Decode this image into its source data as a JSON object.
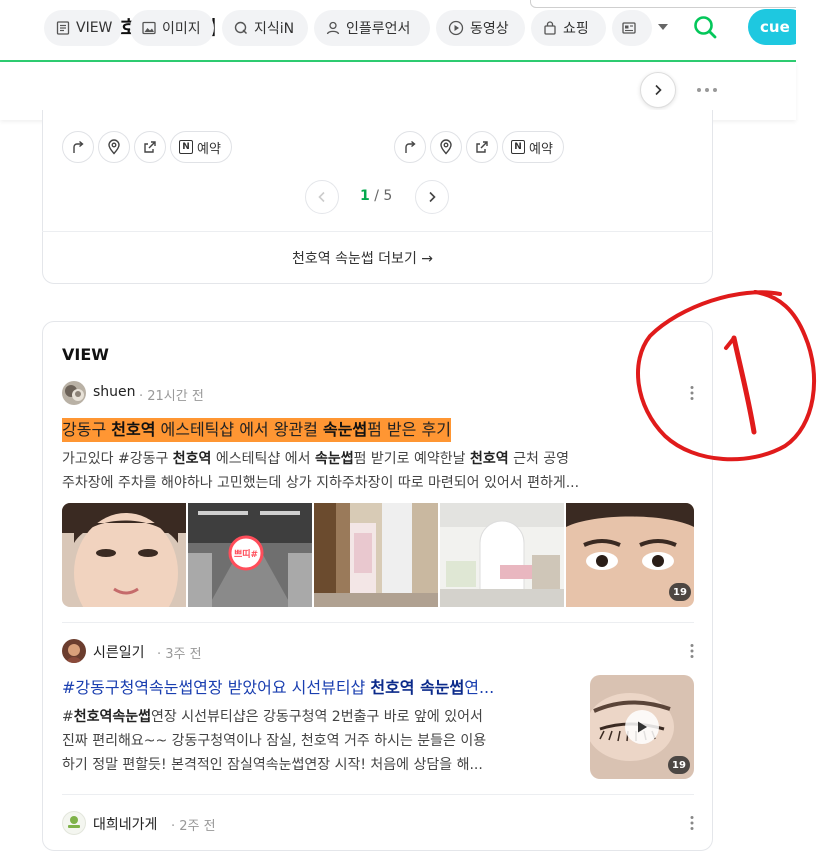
{
  "header": {
    "query": "천호역 속눈썹",
    "cue_label": "cue"
  },
  "tabs": [
    {
      "label": "VIEW",
      "icon": "document-icon"
    },
    {
      "label": "이미지",
      "icon": "image-icon"
    },
    {
      "label": "지식iN",
      "icon": "q-icon"
    },
    {
      "label": "인플루언서",
      "icon": "person-icon"
    },
    {
      "label": "동영상",
      "icon": "play-icon"
    },
    {
      "label": "쇼핑",
      "icon": "bag-icon"
    }
  ],
  "place_card": {
    "reserve_label": "예약",
    "pager": {
      "current": "1",
      "total": "/ 5"
    },
    "more_link": "천호역 속눈썹 더보기 →"
  },
  "view_section": {
    "title": "VIEW",
    "posts": [
      {
        "author": "shuen",
        "ago": "· 21시간 전",
        "title_parts": [
          "강동구 ",
          "천호역",
          " 에스테틱샵 에서 왕관컬 ",
          "속눈썹",
          "펌 받은 후기"
        ],
        "desc_line1_parts": [
          "가고있다 #강동구 ",
          "천호역",
          " 에스테틱샵 에서 ",
          "속눈썹",
          "펌 받기로 예약한날 ",
          "천호역",
          " 근처 공영"
        ],
        "desc_line2": "주차장에 주차를 해야하나 고민했는데 상가 지하주차장이 따로 마련되어 있어서 편하게...",
        "image_count": "19",
        "thumb_sign": "쁘띠#"
      },
      {
        "author": "시른일기",
        "ago": "· 3주 전",
        "title_parts": [
          "#강동구청역속눈썹연장 받았어요 시선뷰티샵 ",
          "천호역 속눈썹",
          "연..."
        ],
        "desc_line1_parts": [
          "#",
          "천호역속눈썹",
          "연장 시선뷰티샵은 강동구청역 2번출구 바로 앞에 있어서"
        ],
        "desc_line2": "진짜 편리해요~~ 강동구청역이나 잠실, 천호역 거주 하시는 분들은 이용",
        "desc_line3": "하기 정말 편할듯! 본격적인 잠실역속눈썹연장 시작! 처음에 상담을 해...",
        "image_count": "19"
      },
      {
        "author": "대희네가게",
        "ago": "· 2주 전"
      }
    ]
  },
  "colors": {
    "naver_green": "#03c75a",
    "cue_cyan": "#1ec8e0",
    "highlight_orange": "#ff9633",
    "link_blue": "#1a3fb0",
    "annotation_red": "#e01b1b"
  }
}
